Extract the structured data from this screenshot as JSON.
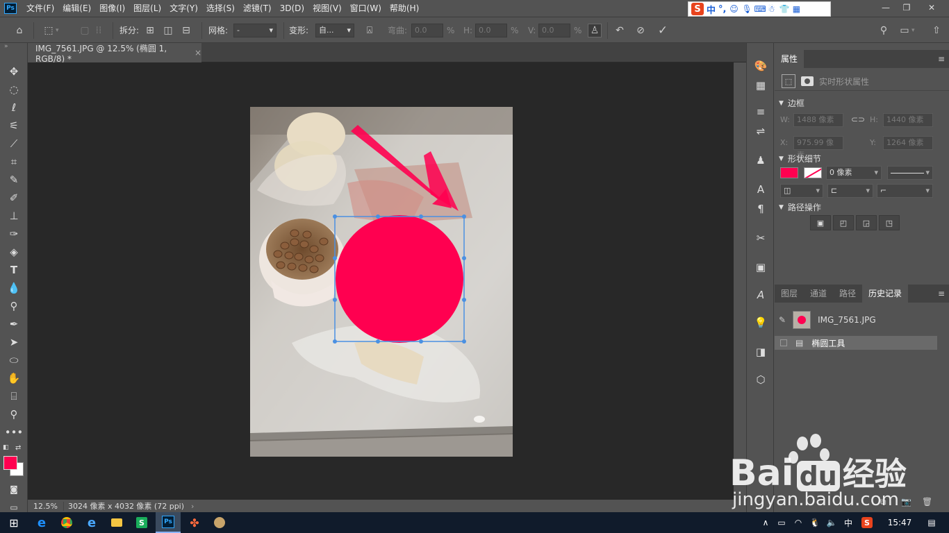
{
  "app": {
    "logo": "Ps"
  },
  "menu": [
    "文件(F)",
    "编辑(E)",
    "图像(I)",
    "图层(L)",
    "文字(Y)",
    "选择(S)",
    "滤镜(T)",
    "3D(D)",
    "视图(V)",
    "窗口(W)",
    "帮助(H)"
  ],
  "ime": {
    "logo": "S",
    "mode": "中",
    "punct": "°,"
  },
  "window_controls": [
    "—",
    "❐",
    "✕"
  ],
  "options": {
    "split_label": "拆分:",
    "grid_label": "网格:",
    "grid_value": "-",
    "warp_label": "变形:",
    "warp_value": "自...",
    "bend_label": "弯曲:",
    "bend_value": "0.0",
    "h_label": "H:",
    "h_value": "0.0",
    "v_label": "V:",
    "v_value": "0.0",
    "percent": "%"
  },
  "doc_tab": {
    "title": "IMG_7561.JPG @ 12.5% (椭圆 1, RGB/8) *",
    "close": "×"
  },
  "status": {
    "zoom": "12.5%",
    "info": "3024 像素 x 4032 像素 (72 ppi)",
    "arrow": "›"
  },
  "colors": {
    "foreground": "#ff0050",
    "background": "#ffffff",
    "shape_fill": "#ff0050",
    "selection": "#4a90e2"
  },
  "properties": {
    "tab": "属性",
    "subtitle": "实时形状属性",
    "border_section": "边框",
    "w_label": "W:",
    "w_value": "1488 像素",
    "h_label": "H:",
    "h_value": "1440 像素",
    "x_label": "X:",
    "x_value": "975.99 像素",
    "y_label": "Y:",
    "y_value": "1264 像素",
    "shape_section": "形状细节",
    "stroke_width": "0 像素",
    "path_section": "路径操作"
  },
  "bottom_panel": {
    "tabs": [
      "图层",
      "通道",
      "路径",
      "历史记录"
    ],
    "active_tab": "历史记录",
    "snapshot_name": "IMG_7561.JPG",
    "history_item": "椭圆工具"
  },
  "taskbar": {
    "time": "15:47",
    "ime_label": "中",
    "apps": [
      "windows-start",
      "ie",
      "chrome",
      "edge",
      "explorer",
      "wps",
      "photoshop",
      "paint",
      "game"
    ]
  },
  "watermark": {
    "brand": "Bai",
    "brand2": "du",
    "cn": "经验",
    "url": "jingyan.baidu.com"
  }
}
